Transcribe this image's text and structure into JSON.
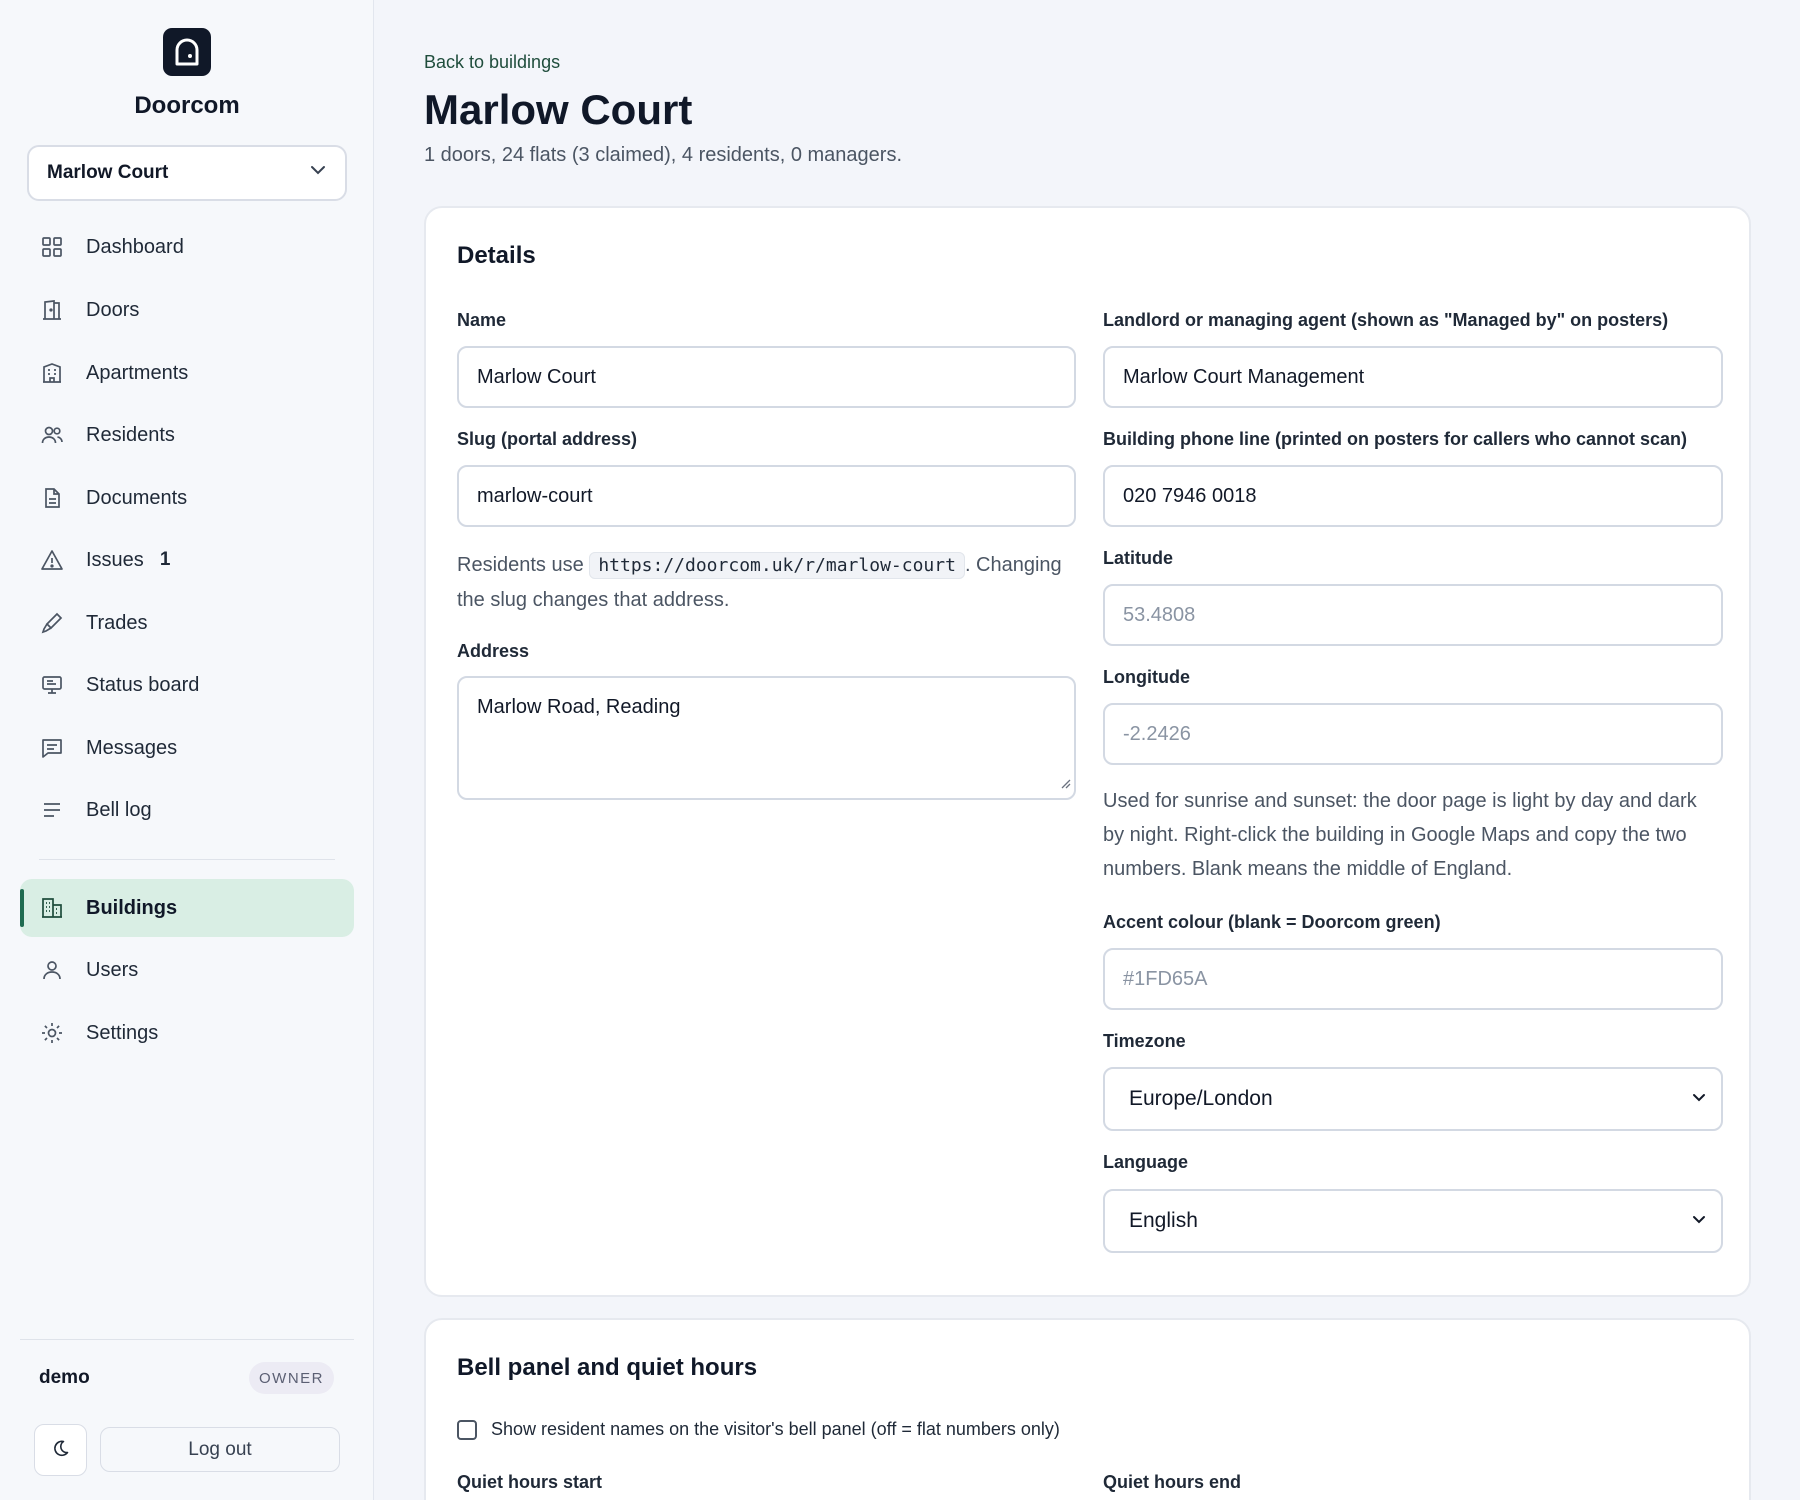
{
  "app": {
    "brand": "Doorcom",
    "selected_building": "Marlow Court"
  },
  "nav": {
    "items": [
      {
        "label": "Dashboard",
        "icon": "dashboard-icon"
      },
      {
        "label": "Doors",
        "icon": "door-icon"
      },
      {
        "label": "Apartments",
        "icon": "apartment-icon"
      },
      {
        "label": "Residents",
        "icon": "residents-icon"
      },
      {
        "label": "Documents",
        "icon": "document-icon"
      },
      {
        "label": "Issues",
        "icon": "warning-icon",
        "count": "1"
      },
      {
        "label": "Trades",
        "icon": "brush-icon"
      },
      {
        "label": "Status board",
        "icon": "monitor-icon"
      },
      {
        "label": "Messages",
        "icon": "message-icon"
      },
      {
        "label": "Bell log",
        "icon": "list-icon"
      },
      {
        "label": "Buildings",
        "icon": "buildings-icon",
        "active": true
      },
      {
        "label": "Users",
        "icon": "user-icon"
      },
      {
        "label": "Settings",
        "icon": "settings-icon"
      }
    ]
  },
  "user": {
    "name": "demo",
    "role": "OWNER",
    "logout_label": "Log out"
  },
  "page": {
    "back_label": "Back to buildings",
    "title": "Marlow Court",
    "subtitle": "1 doors, 24 flats (3 claimed), 4 residents, 0 managers."
  },
  "details": {
    "title": "Details",
    "name_label": "Name",
    "name_value": "Marlow Court",
    "slug_label": "Slug (portal address)",
    "slug_value": "marlow-court",
    "slug_help_prefix": "Residents use",
    "slug_help_code": "https://doorcom.uk/r/marlow-court",
    "slug_help_suffix": ". Changing the slug changes that address.",
    "address_label": "Address",
    "address_value": "Marlow Road, Reading",
    "landlord_label": "Landlord or managing agent (shown as \"Managed by\" on posters)",
    "landlord_value": "Marlow Court Management",
    "phone_label": "Building phone line (printed on posters for callers who cannot scan)",
    "phone_value": "020 7946 0018",
    "latitude_label": "Latitude",
    "latitude_placeholder": "53.4808",
    "longitude_label": "Longitude",
    "longitude_placeholder": "-2.2426",
    "geo_help": "Used for sunrise and sunset: the door page is light by day and dark by night. Right-click the building in Google Maps and copy the two numbers. Blank means the middle of England.",
    "accent_label": "Accent colour (blank = Doorcom green)",
    "accent_placeholder": "#1FD65A",
    "timezone_label": "Timezone",
    "timezone_value": "Europe/London",
    "language_label": "Language",
    "language_value": "English"
  },
  "bell": {
    "title": "Bell panel and quiet hours",
    "show_names_label": "Show resident names on the visitor's bell panel (off = flat numbers only)",
    "quiet_start_label": "Quiet hours start",
    "quiet_end_label": "Quiet hours end"
  },
  "colors": {
    "accent": "#1f6b50",
    "active_nav_bg": "#d9eee4",
    "logo_bg": "#101828"
  }
}
